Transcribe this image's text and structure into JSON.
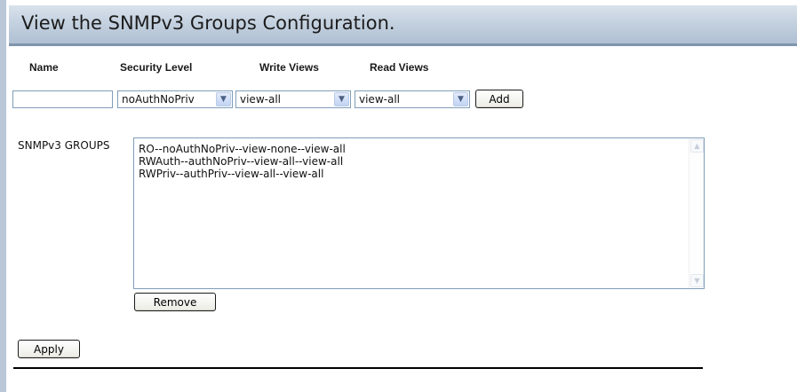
{
  "header": {
    "title": "View the SNMPv3 Groups Configuration."
  },
  "columns": {
    "name": "Name",
    "security_level": "Security Level",
    "write_views": "Write Views",
    "read_views": "Read Views"
  },
  "form": {
    "name_value": "",
    "security_level": "noAuthNoPriv",
    "write_view": "view-all",
    "read_view": "view-all",
    "add_label": "Add"
  },
  "groups": {
    "label": "SNMPv3 GROUPS",
    "items": [
      "RO--noAuthNoPriv--view-none--view-all",
      "RWAuth--authNoPriv--view-all--view-all",
      "RWPriv--authPriv--view-all--view-all"
    ],
    "remove_label": "Remove"
  },
  "apply_label": "Apply",
  "icons": {
    "dropdown": "chevron-down-icon",
    "scroll_up": "scroll-up-arrow-icon",
    "scroll_down": "scroll-down-arrow-icon"
  },
  "colors": {
    "header_bg": "#c4d1df",
    "header_border": "#7f95ad",
    "input_border": "#7f9db9",
    "frame": "#b9c7d6"
  }
}
